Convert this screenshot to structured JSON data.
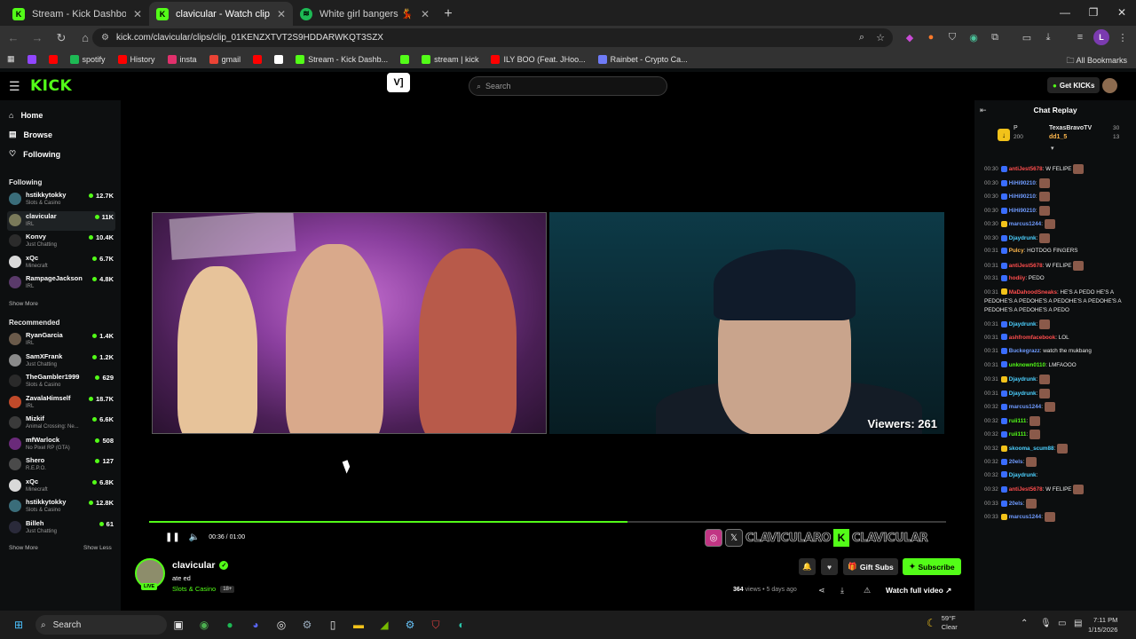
{
  "browser": {
    "tabs": [
      {
        "title": "Stream - Kick Dashboard",
        "icon": "kick-icon"
      },
      {
        "title": "clavicular - Watch clips on K",
        "icon": "kick-icon"
      },
      {
        "title": "White girl bangers 💃 🔥 🕺 🎶",
        "icon": "spotify-icon"
      }
    ],
    "url": "kick.com/clavicular/clips/clip_01KENZXTVT2S9HDDARWKQT3SZX",
    "profile_initial": "L",
    "bookmarks": [
      {
        "label": "",
        "icon": "twitch-icon",
        "color": "#9146ff"
      },
      {
        "label": "",
        "icon": "youtube-icon",
        "color": "#ff0000"
      },
      {
        "label": "spotify",
        "icon": "spotify-icon",
        "color": "#1db954"
      },
      {
        "label": "History",
        "icon": "youtube-icon",
        "color": "#ff0000"
      },
      {
        "label": "insta",
        "icon": "instagram-icon",
        "color": "#e1306c"
      },
      {
        "label": "gmail",
        "icon": "gmail-icon",
        "color": "#ea4335"
      },
      {
        "label": "",
        "icon": "youtube-icon",
        "color": "#ff0000"
      },
      {
        "label": "",
        "icon": "x-icon",
        "color": "#ffffff"
      },
      {
        "label": "Stream - Kick Dashb...",
        "icon": "kick-icon",
        "color": "#53fc18"
      },
      {
        "label": "",
        "icon": "kick-icon",
        "color": "#53fc18"
      },
      {
        "label": "stream | kick",
        "icon": "kick-icon",
        "color": "#53fc18"
      },
      {
        "label": "ILY BOO (Feat. JHoo...",
        "icon": "youtube-icon",
        "color": "#ff0000"
      },
      {
        "label": "Rainbet - Crypto Ca...",
        "icon": "rainbet-icon",
        "color": "#6f7bf7"
      }
    ],
    "all_bookmarks": "All Bookmarks"
  },
  "kick": {
    "search_placeholder": "Search",
    "get_kicks": "Get KICKs",
    "nav": [
      {
        "label": "Home",
        "icon": "home-icon"
      },
      {
        "label": "Browse",
        "icon": "browse-icon"
      },
      {
        "label": "Following",
        "icon": "heart-icon"
      }
    ],
    "following_title": "Following",
    "following": [
      {
        "name": "hstikkytokky",
        "category": "Slots & Casino",
        "viewers": "12.7K",
        "color": "#3a6d7a"
      },
      {
        "name": "clavicular",
        "category": "IRL",
        "viewers": "11K",
        "color": "#7a7a5a",
        "active": true
      },
      {
        "name": "Konvy",
        "category": "Just Chatting",
        "viewers": "10.4K",
        "color": "#2b2b2b"
      },
      {
        "name": "xQc",
        "category": "Minecraft",
        "viewers": "6.7K",
        "color": "#d9d9d9"
      },
      {
        "name": "RampageJackson",
        "category": "IRL",
        "viewers": "4.8K",
        "color": "#5a3a6a"
      }
    ],
    "show_more": "Show More",
    "recommended_title": "Recommended",
    "recommended": [
      {
        "name": "RyanGarcia",
        "category": "IRL",
        "viewers": "1.4K",
        "color": "#6a5a4a"
      },
      {
        "name": "SamXFrank",
        "category": "Just Chatting",
        "viewers": "1.2K",
        "color": "#8a8a8a"
      },
      {
        "name": "TheGambler1999",
        "category": "Slots & Casino",
        "viewers": "629",
        "color": "#2a2a2a"
      },
      {
        "name": "ZavalaHimself",
        "category": "IRL",
        "viewers": "18.7K",
        "color": "#c04a2a"
      },
      {
        "name": "Mizkif",
        "category": "Animal Crossing: Ne...",
        "viewers": "6.6K",
        "color": "#3a3a3a"
      },
      {
        "name": "mfWarlock",
        "category": "No Pixel RP (GTA)",
        "viewers": "508",
        "color": "#6a2a7a"
      },
      {
        "name": "Shero",
        "category": "R.E.P.O.",
        "viewers": "127",
        "color": "#4a4a4a"
      },
      {
        "name": "xQc",
        "category": "Minecraft",
        "viewers": "6.8K",
        "color": "#d9d9d9"
      },
      {
        "name": "hstikkytokky",
        "category": "Slots & Casino",
        "viewers": "12.8K",
        "color": "#3a6d7a"
      },
      {
        "name": "Billeh",
        "category": "Just Chatting",
        "viewers": "61",
        "color": "#2a2a3a"
      }
    ],
    "show_less": "Show Less"
  },
  "player": {
    "viewers_overlay": "Viewers: 261",
    "time": "00:36 / 01:00",
    "progress": 0.6,
    "overlay_brand": "CLAVICULARO",
    "overlay_brand2": "CLAVICULAR"
  },
  "clip": {
    "channel": "clavicular",
    "live_badge": "LIVE",
    "title": "ate ed",
    "category": "Slots & Casino",
    "age_rating": "18+",
    "gift_subs": "Gift Subs",
    "subscribe": "Subscribe",
    "views": "364",
    "views_suffix": "views",
    "ago": "• 5 days ago",
    "watch_full": "Watch full video"
  },
  "chat": {
    "title": "Chat Replay",
    "pinned": {
      "letter": "P",
      "points": "200",
      "user1": "TexasBravoTV",
      "count1": "30",
      "user2": "dd1_5",
      "count2": "13"
    },
    "messages": [
      {
        "t": "00:30",
        "u": "antiJest5678",
        "c": "#ff4d4d",
        "m": ": W FELIPE",
        "emo": true
      },
      {
        "t": "00:30",
        "u": "HiHi90210",
        "c": "#6f9bff",
        "m": ":",
        "emo": true
      },
      {
        "t": "00:30",
        "u": "HiHi90210",
        "c": "#6f9bff",
        "m": ":",
        "emo": true
      },
      {
        "t": "00:30",
        "u": "HiHi90210",
        "c": "#6f9bff",
        "m": ":",
        "emo": true
      },
      {
        "t": "00:30",
        "u": "marcus1244",
        "c": "#6f9bff",
        "m": ":",
        "emo": true
      },
      {
        "t": "00:30",
        "u": "Djaydrunk",
        "c": "#4cd0ff",
        "m": ":",
        "emo": true
      },
      {
        "t": "00:31",
        "u": "Pulcy",
        "c": "#ffb84d",
        "m": ": HOTDOG FINGERS",
        "emo": false
      },
      {
        "t": "00:31",
        "u": "antiJest5678",
        "c": "#ff4d4d",
        "m": ": W FELIPE",
        "emo": true
      },
      {
        "t": "00:31",
        "u": "hodiiy",
        "c": "#ff4d4d",
        "m": ": PEDO",
        "emo": false
      },
      {
        "t": "00:31",
        "u": "MaDahoodSneaks",
        "c": "#ff4d4d",
        "m": ": HE'S A PEDO HE'S A PEDOHE'S A PEDOHE'S A PEDOHE'S A PEDOHE'S A PEDOHE'S A PEDOHE'S A PEDO",
        "emo": false
      },
      {
        "t": "00:31",
        "u": "Djaydrunk",
        "c": "#4cd0ff",
        "m": ":",
        "emo": true
      },
      {
        "t": "00:31",
        "u": "ashfromfacebook",
        "c": "#ff4d4d",
        "m": ": LOL",
        "emo": false
      },
      {
        "t": "00:31",
        "u": "Buckegrazz",
        "c": "#6f9bff",
        "m": ": watch the mukbang",
        "emo": false
      },
      {
        "t": "00:31",
        "u": "unknown0110",
        "c": "#53fc18",
        "m": ": LMFAOOO",
        "emo": false
      },
      {
        "t": "00:31",
        "u": "Djaydrunk",
        "c": "#4cd0ff",
        "m": ":",
        "emo": true
      },
      {
        "t": "00:31",
        "u": "Djaydrunk",
        "c": "#4cd0ff",
        "m": ":",
        "emo": true
      },
      {
        "t": "00:32",
        "u": "marcus1244",
        "c": "#6f9bff",
        "m": ":",
        "emo": true
      },
      {
        "t": "00:32",
        "u": "ruii111",
        "c": "#53fc18",
        "m": ":",
        "emo": true
      },
      {
        "t": "00:32",
        "u": "ruii111",
        "c": "#53fc18",
        "m": ":",
        "emo": true
      },
      {
        "t": "00:32",
        "u": "skooma_scum88",
        "c": "#4cd0ff",
        "m": ":",
        "emo": true
      },
      {
        "t": "00:32",
        "u": "20els",
        "c": "#6f9bff",
        "m": ":",
        "emo": true
      },
      {
        "t": "00:32",
        "u": "Djaydrunk",
        "c": "#4cd0ff",
        "m": ":",
        "emo": false
      },
      {
        "t": "00:32",
        "u": "antiJest5678",
        "c": "#ff4d4d",
        "m": ": W FELIPE",
        "emo": true
      },
      {
        "t": "00:33",
        "u": "20els",
        "c": "#6f9bff",
        "m": ":",
        "emo": true
      },
      {
        "t": "00:33",
        "u": "marcus1244",
        "c": "#6f9bff",
        "m": ":",
        "emo": true
      }
    ]
  },
  "taskbar": {
    "search": "Search",
    "temp": "59°F",
    "weather": "Clear",
    "time": "7:11 PM",
    "date": "1/15/2026"
  }
}
